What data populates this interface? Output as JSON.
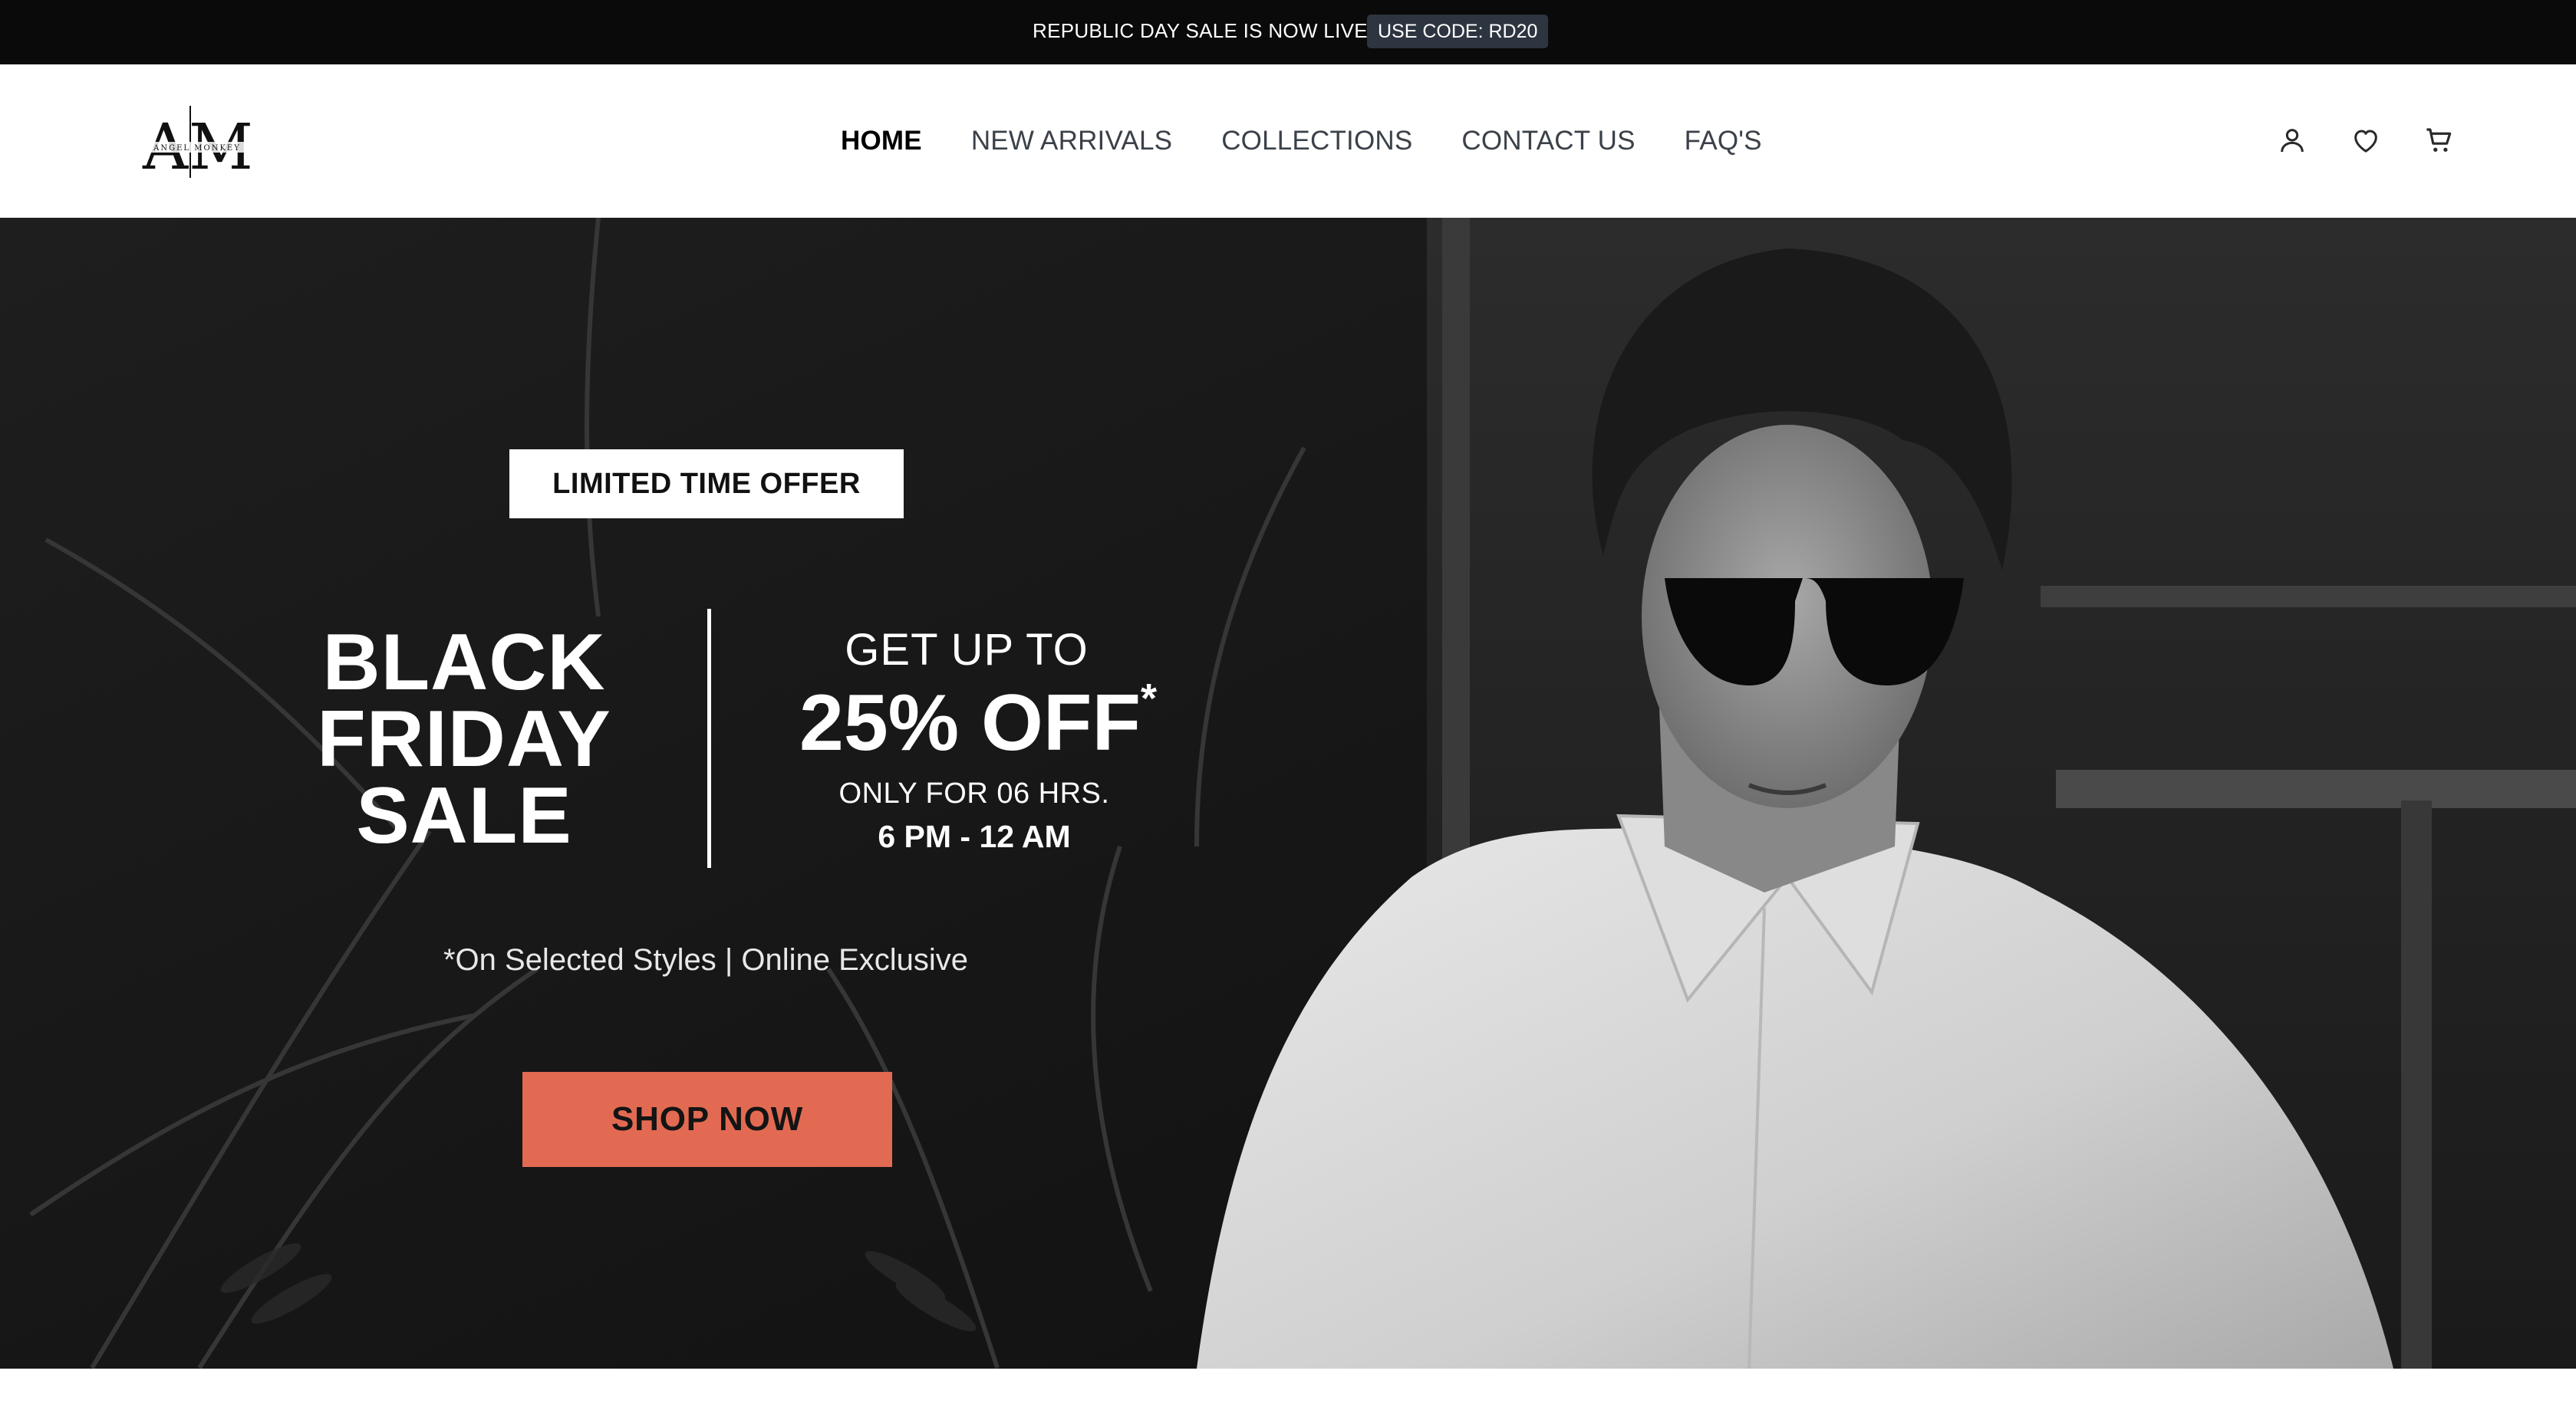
{
  "announcement": {
    "text": "REPUBLIC DAY SALE IS NOW LIVE",
    "bolt": "⚡",
    "code_label": "USE CODE: RD20"
  },
  "header": {
    "logo_alt": "Angel Monkey logo",
    "logo_text": "ANGEL MONKEY",
    "nav": [
      {
        "label": "HOME",
        "active": true
      },
      {
        "label": "NEW ARRIVALS"
      },
      {
        "label": "COLLECTIONS"
      },
      {
        "label": "CONTACT US"
      },
      {
        "label": "FAQ'S"
      }
    ],
    "icons": [
      "account-icon",
      "wishlist-icon",
      "cart-icon"
    ]
  },
  "hero": {
    "badge": "LIMITED TIME OFFER",
    "title_lines": [
      "BLACK",
      "FRIDAY",
      "SALE"
    ],
    "get_up_to": "GET UP TO",
    "discount": "25% OFF",
    "discount_mark": "*",
    "duration": "ONLY FOR 06 HRS.",
    "time_window": "6 PM - 12 AM",
    "note": "*On Selected Styles | Online Exclusive",
    "cta": "SHOP NOW"
  },
  "colors": {
    "announcement_bg": "#0a0a0a",
    "code_pill_bg": "#2d3540",
    "cta_bg": "#e36a52",
    "hero_bg": "#161616"
  }
}
